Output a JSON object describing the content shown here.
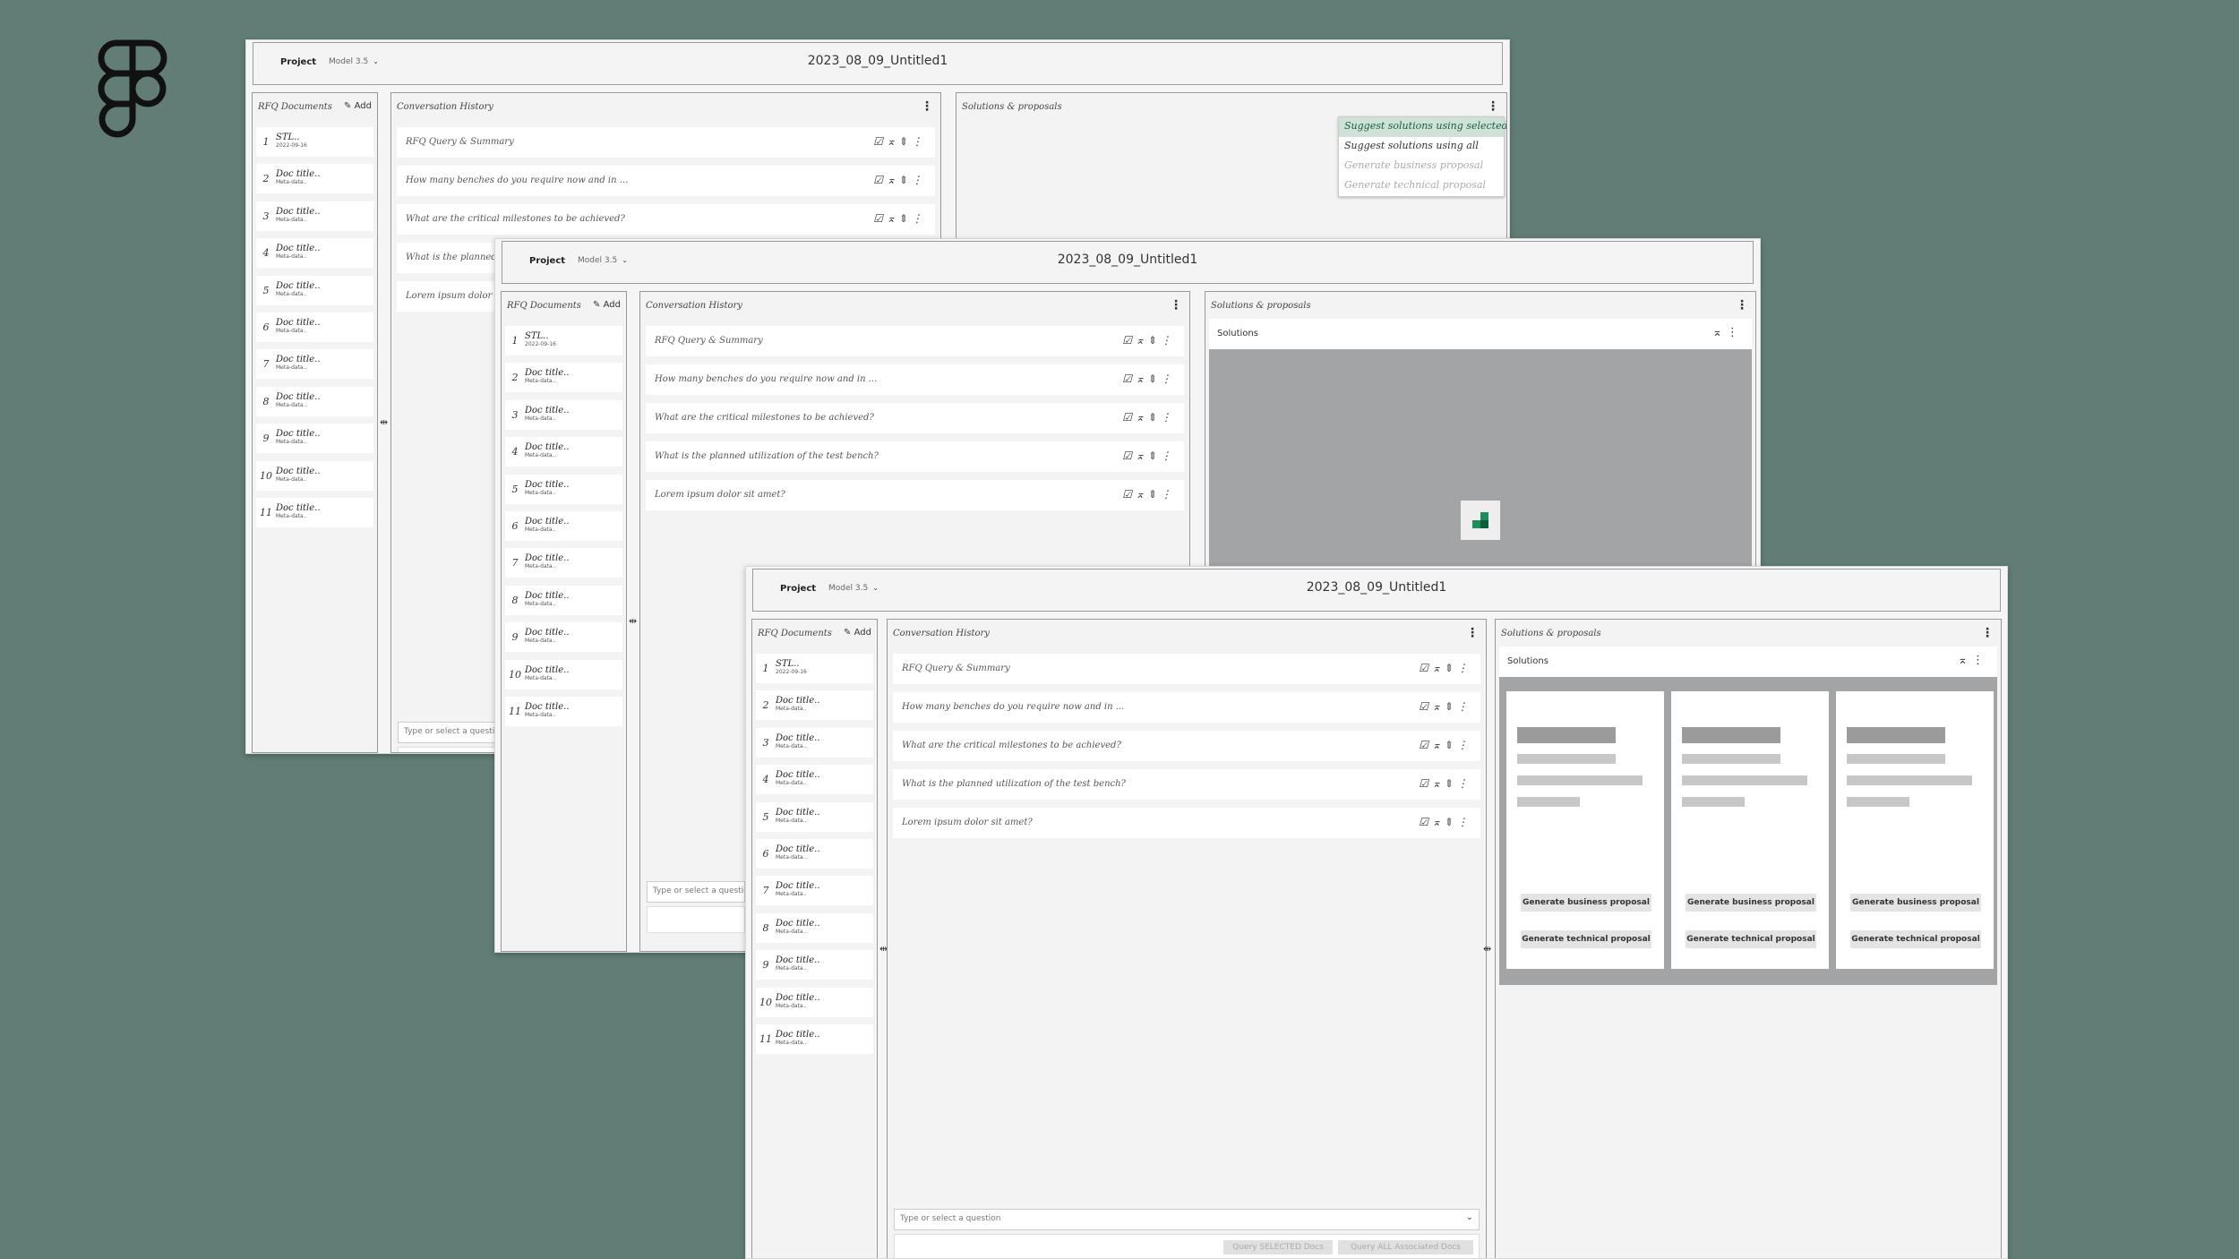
{
  "colors": {
    "background": "#617d76",
    "accent": "#1d8f5c",
    "menu_selected": "#cfe2d8"
  },
  "logo": {
    "name": "figma-logo"
  },
  "project_label": "Project",
  "model_label": "Model 3.5",
  "document_title": "2023_08_09_Untitled1",
  "docs_panel": {
    "title": "RFQ Documents",
    "add_label": "Add",
    "items": [
      {
        "num": "1",
        "title": "STL..",
        "meta": "2022-09-16"
      },
      {
        "num": "2",
        "title": "Doc title..",
        "meta": "Meta-data.."
      },
      {
        "num": "3",
        "title": "Doc title..",
        "meta": "Meta-data.."
      },
      {
        "num": "4",
        "title": "Doc title..",
        "meta": "Meta-data.."
      },
      {
        "num": "5",
        "title": "Doc title..",
        "meta": "Meta-data.."
      },
      {
        "num": "6",
        "title": "Doc title..",
        "meta": "Meta-data.."
      },
      {
        "num": "7",
        "title": "Doc title..",
        "meta": "Meta-data.."
      },
      {
        "num": "8",
        "title": "Doc title..",
        "meta": "Meta-data.."
      },
      {
        "num": "9",
        "title": "Doc title..",
        "meta": "Meta-data.."
      },
      {
        "num": "10",
        "title": "Doc title..",
        "meta": "Meta-data.."
      },
      {
        "num": "11",
        "title": "Doc title..",
        "meta": "Meta-data.."
      }
    ]
  },
  "conversation": {
    "title": "Conversation History",
    "questions": [
      "RFQ Query & Summary",
      "How many benches do you require now and in ...",
      "What are the critical milestones to be achieved?",
      "What is the planned utilization of the test bench?",
      "Lorem ipsum dolor sit amet?"
    ],
    "questions_truncated": [
      "RFQ Query & Summary",
      "How many benches do you require now and in ...",
      "What are the critical milestones to be achieved?",
      "What is the planned ut",
      "Lorem ipsum dolor si"
    ],
    "input_placeholder": "Type or select a question",
    "input_placeholder_short": "Type or select a questio",
    "query_selected_label": "Query SELECTED Docs",
    "query_all_label": "Query ALL Associated Docs"
  },
  "solutions_panel": {
    "title": "Solutions & proposals",
    "sub_title": "Solutions",
    "menu": [
      {
        "label": "Suggest solutions using selected",
        "state": "selected"
      },
      {
        "label": "Suggest solutions using all",
        "state": "enabled"
      },
      {
        "label": "Generate business proposal",
        "state": "disabled"
      },
      {
        "label": "Generate technical proposal",
        "state": "disabled"
      }
    ],
    "cards": [
      {
        "business_label": "Generate business proposal",
        "technical_label": "Generate technical proposal"
      },
      {
        "business_label": "Generate business proposal",
        "technical_label": "Generate technical proposal"
      },
      {
        "business_label": "Generate business proposal",
        "technical_label": "Generate technical proposal"
      }
    ]
  },
  "icons": {
    "checkbox": "checkbox-icon",
    "collapse": "collapse-icon",
    "expand": "expand-icon",
    "kebab": "kebab-icon",
    "resize": "resize-handle-icon",
    "chevron": "chevron-down-icon"
  }
}
